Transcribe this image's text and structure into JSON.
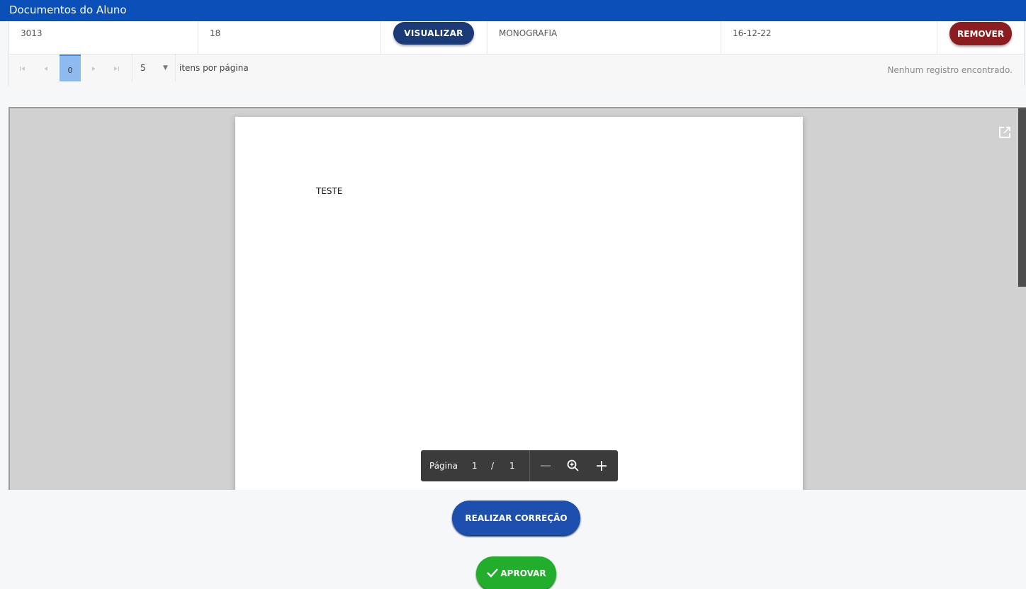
{
  "header": {
    "title": "Documentos do Aluno"
  },
  "table": {
    "rows": [
      {
        "col1": "3013",
        "col2": "18",
        "view_button": "VISUALIZAR",
        "type": "MONOGRAFIA",
        "date": "16-12-22",
        "remove_button": "REMOVER"
      }
    ]
  },
  "pager": {
    "current_page": "0",
    "page_size": "5",
    "items_per_page_label": "itens por página",
    "info": "Nenhum registro encontrado."
  },
  "pdf_viewer": {
    "content_text": "TESTE",
    "toolbar": {
      "page_label": "Página",
      "current_page": "1",
      "separator": "/",
      "total_pages": "1"
    },
    "icons": [
      "first-page-icon",
      "prev-page-icon",
      "next-page-icon",
      "last-page-icon",
      "open-external-icon",
      "zoom-out-icon",
      "zoom-fit-icon",
      "zoom-in-icon"
    ]
  },
  "actions": {
    "correct_button": "REALIZAR CORREÇÃO",
    "approve_button": "APROVAR"
  },
  "colors": {
    "header_bg": "#0b50b8",
    "view_button": "#1b3a78",
    "remove_button": "#8b1c1f",
    "correct_button": "#1d4fae",
    "approve_button": "#22ad2c"
  }
}
